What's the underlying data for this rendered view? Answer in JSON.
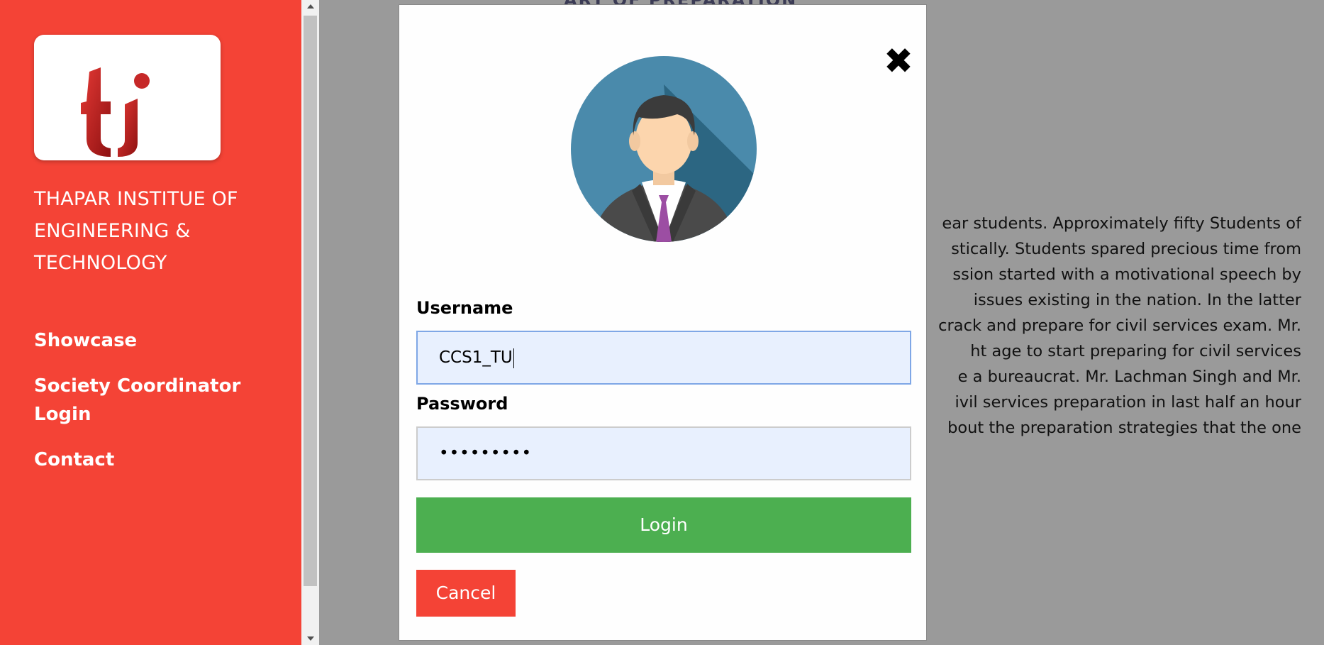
{
  "sidebar": {
    "logo_icon": "ti-logo-icon",
    "institute_name": [
      "THAPAR INSTITUE OF",
      "ENGINEERING &",
      "TECHNOLOGY"
    ],
    "nav": [
      {
        "label": "Showcase"
      },
      {
        "label": "Society Coordinator Login"
      },
      {
        "label": "Contact"
      }
    ]
  },
  "background_page": {
    "heading": "ART OF PREPARATION",
    "paragraph_lines": [
      "ear students. Approximately fifty Students of",
      "stically. Students spared precious time from",
      "ssion started with a motivational speech by",
      "issues existing in the nation.  In the latter",
      "crack and prepare for civil services exam. Mr.",
      "ht age to start preparing for civil services",
      "e a bureaucrat. Mr. Lachman Singh and Mr.",
      "ivil services preparation in last half an hour",
      "bout the preparation strategies that the one"
    ]
  },
  "modal": {
    "close_icon": "close-icon",
    "avatar_icon": "user-avatar-icon",
    "username_label": "Username",
    "username_value": "CCS1_TU",
    "password_label": "Password",
    "password_value": "•••••••••",
    "login_label": "Login",
    "cancel_label": "Cancel"
  },
  "colors": {
    "sidebar_bg": "#f44336",
    "login_button": "#4caf50",
    "cancel_button": "#f44336",
    "input_bg": "#e8f0fe",
    "overlay": "#9a9a9a"
  }
}
